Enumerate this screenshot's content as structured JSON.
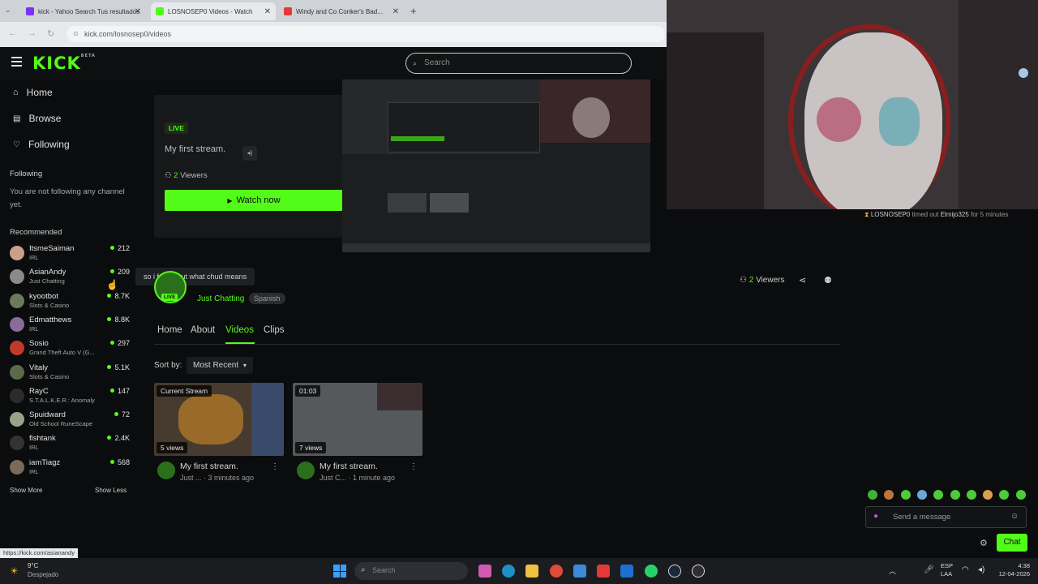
{
  "browser": {
    "tabs": [
      {
        "title": "kick - Yahoo Search Tus resultados",
        "fav_color": "#7b2ff7"
      },
      {
        "title": "LOSNOSEP0 Videos - Watch",
        "fav_color": "#53fc18"
      },
      {
        "title": "Windy and Co Conker's Bad...",
        "fav_color": "#e53935"
      }
    ],
    "url": "kick.com/losnosep0/videos"
  },
  "header": {
    "logo": "KICK",
    "logo_beta": "BETA",
    "search_placeholder": "Search"
  },
  "sidebar": {
    "nav": [
      {
        "label": "Home",
        "icon": "home-icon"
      },
      {
        "label": "Browse",
        "icon": "browse-icon"
      },
      {
        "label": "Following",
        "icon": "heart-icon"
      }
    ],
    "following_title": "Following",
    "following_empty": "You are not following any channel yet.",
    "recommended_title": "Recommended",
    "recommended": [
      {
        "name": "ItsmeSaiman",
        "category": "IRL",
        "viewers": "212",
        "color": "#c9a08a"
      },
      {
        "name": "AsianAndy",
        "category": "Just Chatting",
        "viewers": "209",
        "color": "#8a8a8a"
      },
      {
        "name": "kyootbot",
        "category": "Slots & Casino",
        "viewers": "8.7K",
        "color": "#6b7a5a"
      },
      {
        "name": "Edmatthews",
        "category": "IRL",
        "viewers": "8.8K",
        "color": "#8a6b9a"
      },
      {
        "name": "Sosio",
        "category": "Grand Theft Auto V (G...",
        "viewers": "297",
        "color": "#c0392b"
      },
      {
        "name": "Vitaly",
        "category": "Slots & Casino",
        "viewers": "5.1K",
        "color": "#5a6a4a"
      },
      {
        "name": "RayC",
        "category": "S.T.A.L.K.E.R.: Anomaly",
        "viewers": "147",
        "color": "#2c2c2c"
      },
      {
        "name": "Spuidward",
        "category": "Old School RuneScape",
        "viewers": "72",
        "color": "#9aa08a"
      },
      {
        "name": "fishtank",
        "category": "IRL",
        "viewers": "2.4K",
        "color": "#333"
      },
      {
        "name": "iamTiagz",
        "category": "IRL",
        "viewers": "568",
        "color": "#7a6a5a"
      }
    ],
    "show_more": "Show More",
    "show_less": "Show Less"
  },
  "live_card": {
    "live_label": "LIVE",
    "stream_title": "My first stream.",
    "viewers_count": "2",
    "viewers_label": "Viewers",
    "watch_now": "Watch now"
  },
  "tooltip": "so i found out what chud means",
  "channel": {
    "live_badge": "LIVE",
    "category": "Just Chatting",
    "language": "Spanish",
    "viewers_count": "2",
    "viewers_label": "Viewers"
  },
  "tabs": [
    "Home",
    "About",
    "Videos",
    "Clips"
  ],
  "sort": {
    "label": "Sort by:",
    "value": "Most Recent"
  },
  "videos": [
    {
      "badge": "Current Stream",
      "views": "5 views",
      "title": "My first stream.",
      "meta": "Just ... · 3 minutes ago"
    },
    {
      "badge": "01:03",
      "views": "7 views",
      "title": "My first stream.",
      "meta": "Just C... · 1 minute ago"
    }
  ],
  "chat": {
    "system_msg_user": "LOSNOSEP0",
    "system_msg_text": "timed out",
    "system_msg_target": "Elmijo325",
    "system_msg_duration": "for 5 minutes",
    "input_placeholder": "Send a message",
    "send_label": "Chat"
  },
  "statusbar_url": "https://kick.com/asianandy",
  "taskbar": {
    "weather_temp": "9°C",
    "weather_desc": "Despejado",
    "search_placeholder": "Search",
    "lang": "ESP",
    "lang_sub": "LAA",
    "time": "4:38",
    "date": "12-04-2026"
  }
}
